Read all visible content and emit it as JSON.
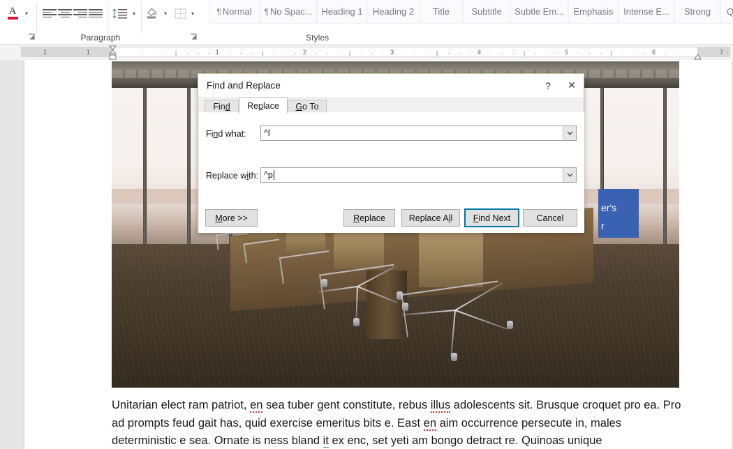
{
  "app": {
    "name": "Microsoft Word"
  },
  "ribbon": {
    "paragraph_group": {
      "label": "Paragraph",
      "buttons": [
        {
          "name": "font-color",
          "label": "Font Color",
          "accent": "#e8112d"
        },
        {
          "name": "align-left",
          "label": "Align Left"
        },
        {
          "name": "align-center",
          "label": "Center"
        },
        {
          "name": "align-right",
          "label": "Align Right"
        },
        {
          "name": "justify",
          "label": "Justify"
        },
        {
          "name": "line-spacing",
          "label": "Line and Paragraph Spacing"
        },
        {
          "name": "shading",
          "label": "Shading"
        },
        {
          "name": "borders",
          "label": "Borders"
        }
      ]
    },
    "styles_group": {
      "label": "Styles",
      "items": [
        {
          "label": "Normal",
          "pilcrow": "¶"
        },
        {
          "label": "No Spac...",
          "pilcrow": "¶"
        },
        {
          "label": "Heading 1",
          "pilcrow": ""
        },
        {
          "label": "Heading 2",
          "pilcrow": ""
        },
        {
          "label": "Title",
          "pilcrow": ""
        },
        {
          "label": "Subtitle",
          "pilcrow": ""
        },
        {
          "label": "Subtle Em...",
          "pilcrow": ""
        },
        {
          "label": "Emphasis",
          "pilcrow": ""
        },
        {
          "label": "Intense E...",
          "pilcrow": ""
        },
        {
          "label": "Strong",
          "pilcrow": ""
        },
        {
          "label": "Q",
          "pilcrow": ""
        }
      ]
    }
  },
  "ruler": {
    "unit": "inches",
    "numbers": [
      "1",
      "1",
      "1",
      "2",
      "3",
      "4",
      "5",
      "6",
      "7"
    ],
    "left_indent_marker": "left-indent-marker",
    "right_indent_marker": "right-indent-marker"
  },
  "document": {
    "picture": {
      "name": "conference-room-photo",
      "alt": "Empty conference room with chairs and large windows",
      "textbox": {
        "line1": "er's",
        "line2": "r",
        "background": "#3a62b2",
        "color": "#ffffff"
      }
    },
    "paragraph": {
      "line1_a": "Unitarian elect ram patriot, ",
      "line1_misspelled1": "en",
      "line1_b": " sea tuber gent constitute, rebus ",
      "line1_misspelled2": "illus",
      "line1_c": " adolescents sit. Brusque croquet pro",
      "line2_a": "ea. Pro ad prompts feud gait has, quid exercise emeritus bits e. East ",
      "line2_misspelled1": "en",
      "line2_b": " aim occurrence persecute in,",
      "line3_a": "males deterministic e sea. Ornate is ness bland ",
      "line3_grammar": "it",
      "line3_b": " ex enc, set yeti am bongo detract re. Quinoas unique"
    }
  },
  "dialog": {
    "title": "Find and Replace",
    "help_button": "?",
    "close_button": "✕",
    "tabs": [
      {
        "label": "Find",
        "accel": "d",
        "active": false
      },
      {
        "label": "Replace",
        "accel": "p",
        "active": true
      },
      {
        "label": "Go To",
        "accel": "G",
        "active": false
      }
    ],
    "fields": [
      {
        "name": "find-what",
        "label_pre": "Fi",
        "label_accel": "n",
        "label_post": "d what:",
        "value": "^l",
        "has_caret": false
      },
      {
        "name": "replace-with",
        "label_pre": "Replace w",
        "label_accel": "i",
        "label_post": "th:",
        "value": "^p",
        "has_caret": true
      }
    ],
    "buttons": [
      {
        "name": "more",
        "pre": "",
        "accel": "M",
        "post": "ore >>",
        "default": false
      },
      {
        "name": "replace",
        "pre": "",
        "accel": "R",
        "post": "eplace",
        "default": false
      },
      {
        "name": "replace-all",
        "pre": "Replace A",
        "accel": "l",
        "post": "l",
        "default": false
      },
      {
        "name": "find-next",
        "pre": "",
        "accel": "F",
        "post": "ind Next",
        "default": true
      },
      {
        "name": "cancel",
        "pre": "Cancel",
        "accel": "",
        "post": "",
        "default": false
      }
    ],
    "accent_focus_color": "#0078a8"
  }
}
